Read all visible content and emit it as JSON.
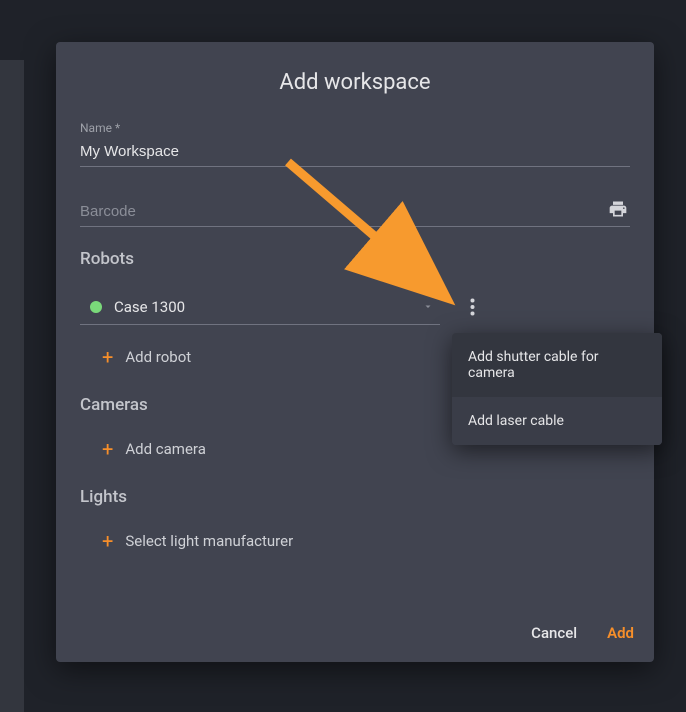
{
  "modal": {
    "title": "Add workspace",
    "name_label": "Name *",
    "name_value": "My Workspace",
    "barcode_placeholder": "Barcode",
    "cancel": "Cancel",
    "add": "Add"
  },
  "sections": {
    "robots": "Robots",
    "cameras": "Cameras",
    "lights": "Lights"
  },
  "robot": {
    "selected": "Case 1300"
  },
  "addlinks": {
    "robot": "Add robot",
    "camera": "Add camera",
    "light": "Select light manufacturer"
  },
  "popover": {
    "item1": "Add shutter cable for camera",
    "item2": "Add laser cable"
  }
}
